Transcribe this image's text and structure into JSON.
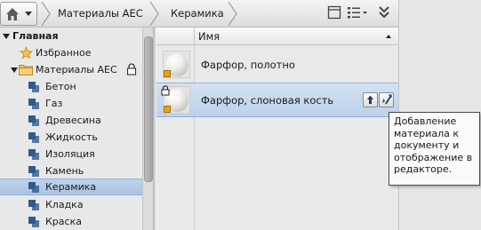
{
  "breadcrumb": {
    "items": [
      "Материалы AEC",
      "Керамика"
    ]
  },
  "tree": {
    "root_label": "Главная",
    "favorites_label": "Избранное",
    "library_label": "Материалы AEC",
    "categories": [
      "Бетон",
      "Газ",
      "Древесина",
      "Жидкость",
      "Изоляция",
      "Камень",
      "Керамика",
      "Кладка",
      "Краска"
    ],
    "selected": "Керамика"
  },
  "list": {
    "column_header": "Имя",
    "sort": "ascending",
    "rows": [
      {
        "name": "Фарфор, полотно"
      },
      {
        "name": "Фарфор, слоновая кость"
      }
    ]
  },
  "tooltip": {
    "lines": [
      "Добавление",
      "материала к",
      "документу и",
      "отображение в",
      "редакторе."
    ]
  },
  "colors": {
    "selection": "#bcd1ea",
    "folder": "#e8a317",
    "material_icon": "#2f5a8c"
  }
}
